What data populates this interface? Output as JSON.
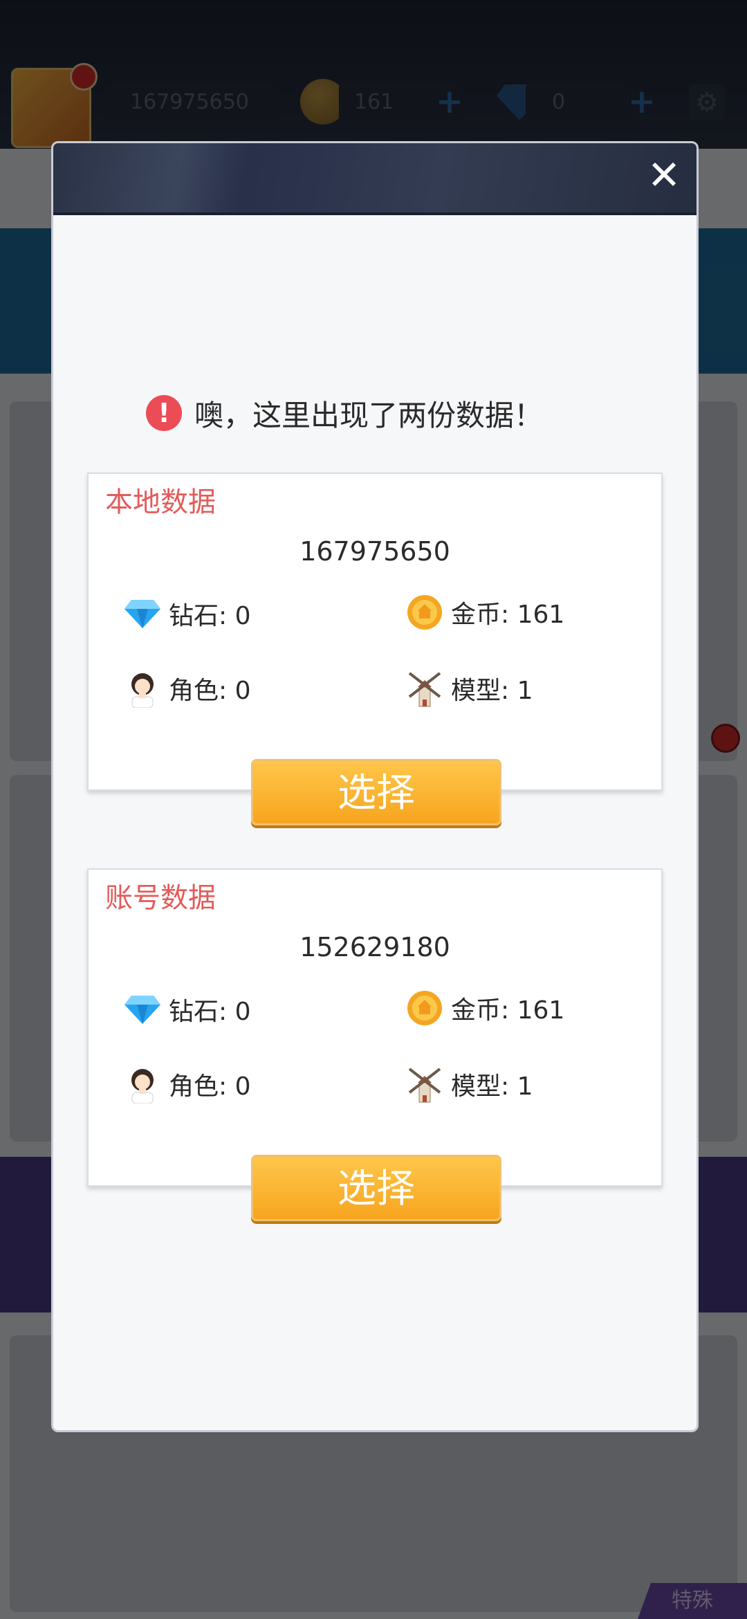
{
  "top_bar": {
    "player_id": "167975650",
    "coins": "161",
    "gems": "0"
  },
  "background": {
    "bottom_tag": "特殊"
  },
  "modal": {
    "alert_text": "噢，这里出现了两份数据！",
    "local": {
      "title": "本地数据",
      "id": "167975650",
      "gems": "钻石: 0",
      "coins": "金币: 161",
      "roles": "角色: 0",
      "models": "模型: 1",
      "select_label": "选择"
    },
    "account": {
      "title": "账号数据",
      "id": "152629180",
      "gems": "钻石: 0",
      "coins": "金币: 161",
      "roles": "角色: 0",
      "models": "模型: 1",
      "select_label": "选择"
    }
  },
  "colors": {
    "accent_red": "#e35b5b",
    "button_orange": "#f7a51f",
    "header_dark": "#2a3246"
  }
}
